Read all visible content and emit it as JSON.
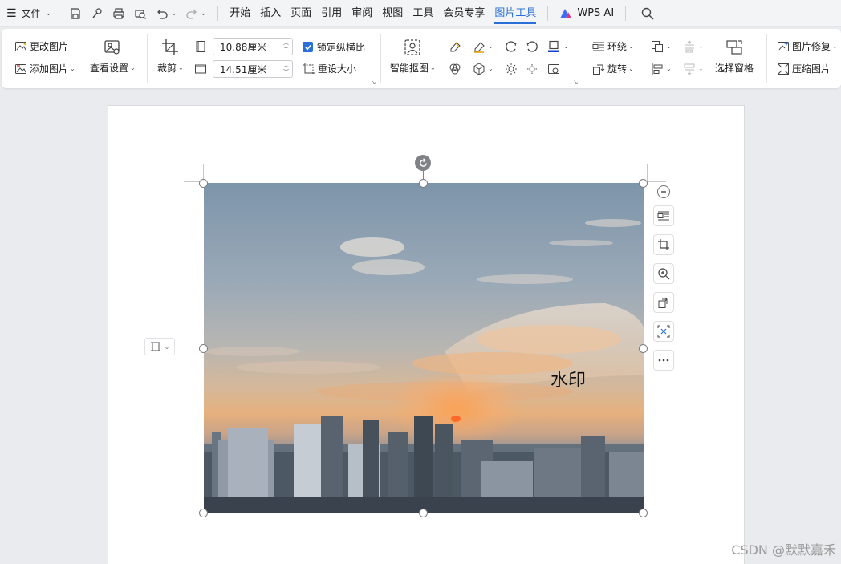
{
  "menubar": {
    "file_label": "文件",
    "tabs": [
      {
        "label": "开始",
        "active": false
      },
      {
        "label": "插入",
        "active": false
      },
      {
        "label": "页面",
        "active": false
      },
      {
        "label": "引用",
        "active": false
      },
      {
        "label": "审阅",
        "active": false
      },
      {
        "label": "视图",
        "active": false
      },
      {
        "label": "工具",
        "active": false
      },
      {
        "label": "会员专享",
        "active": false
      },
      {
        "label": "图片工具",
        "active": true
      }
    ],
    "ai_label": "WPS AI",
    "accent_color": "#2a6fd6"
  },
  "ribbon": {
    "change_image": "更改图片",
    "add_image": "添加图片",
    "view_settings": "查看设置",
    "crop": "裁剪",
    "width_value": "10.88厘米",
    "height_value": "14.51厘米",
    "lock_ratio": "锁定纵横比",
    "reset_size": "重设大小",
    "smart_cutout": "智能抠图",
    "wrap": "环绕",
    "rotate": "旋转",
    "selection_pane": "选择窗格",
    "image_repair": "图片修复",
    "compress_image": "压缩图片"
  },
  "document": {
    "watermark_text": "水印"
  },
  "footer": {
    "csdn_credit": "CSDN @默默嘉禾"
  }
}
